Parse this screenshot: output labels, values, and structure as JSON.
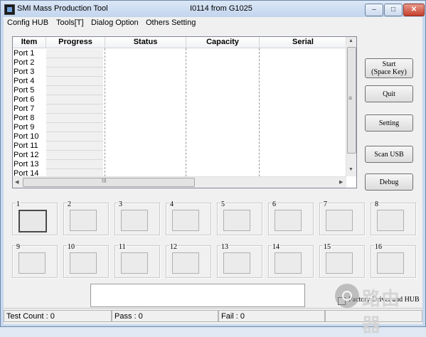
{
  "window": {
    "title": "SMI Mass Production Tool",
    "subtitle": "I0114 from G1025",
    "min_label": "–",
    "max_label": "□",
    "close_label": "✕"
  },
  "menu": [
    "Config HUB",
    "Tools[T]",
    "Dialog Option",
    "Others Setting"
  ],
  "table": {
    "columns": [
      "Item",
      "Progress",
      "Status",
      "Capacity",
      "Serial"
    ],
    "ports": [
      "Port 1",
      "Port 2",
      "Port 3",
      "Port 4",
      "Port 5",
      "Port 6",
      "Port 7",
      "Port 8",
      "Port 9",
      "Port 10",
      "Port 11",
      "Port 12",
      "Port 13",
      "Port 14"
    ],
    "hscroll_grip": "III",
    "vscroll_grip": "≡",
    "arrow_up": "▲",
    "arrow_down": "▼",
    "arrow_left": "◀",
    "arrow_right": "▶"
  },
  "buttons": {
    "start_line1": "Start",
    "start_line2": "(Space Key)",
    "quit": "Quit",
    "setting": "Setting",
    "scan_usb": "Scan USB",
    "debug": "Debug"
  },
  "slots": [
    "1",
    "2",
    "3",
    "4",
    "5",
    "6",
    "7",
    "8",
    "9",
    "10",
    "11",
    "12",
    "13",
    "14",
    "15",
    "16"
  ],
  "factory_label": "Factory Driver and HUB",
  "status": {
    "test_count": "Test Count : 0",
    "pass": "Pass : 0",
    "fail": "Fail : 0"
  },
  "watermark": "路由器"
}
